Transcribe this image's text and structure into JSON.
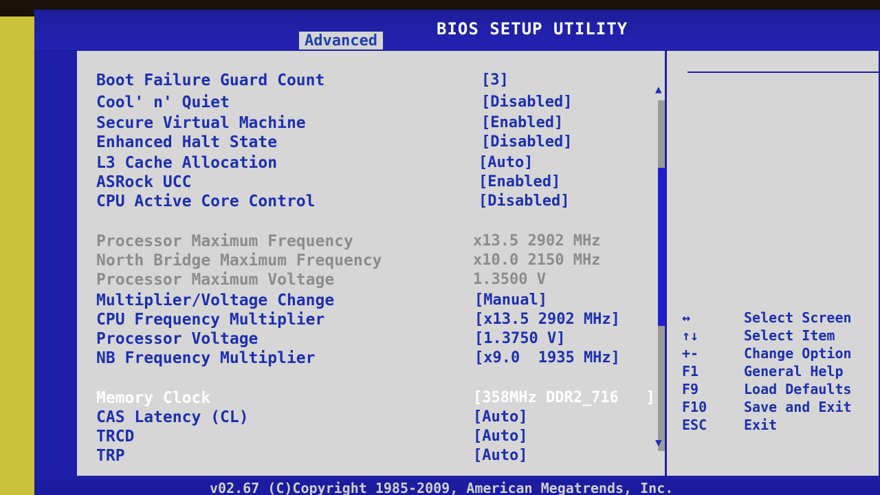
{
  "window": {
    "title": "BIOS SETUP UTILITY",
    "active_tab": "Advanced"
  },
  "settings": [
    {
      "label": "Boot Failure Guard Count",
      "value": "[3]",
      "kind": "setting"
    },
    {
      "label": "Cool' n' Quiet",
      "value": "[Disabled]",
      "kind": "setting"
    },
    {
      "label": "Secure Virtual Machine",
      "value": "[Enabled]",
      "kind": "setting"
    },
    {
      "label": "Enhanced Halt State",
      "value": "[Disabled]",
      "kind": "setting"
    },
    {
      "label": "L3 Cache Allocation",
      "value": "[Auto]",
      "kind": "setting"
    },
    {
      "label": "ASRock UCC",
      "value": "[Enabled]",
      "kind": "setting"
    },
    {
      "label": "CPU Active Core Control",
      "value": "[Disabled]",
      "kind": "setting"
    },
    {
      "label": "Processor Maximum Frequency",
      "value": "x13.5 2902 MHz",
      "kind": "info"
    },
    {
      "label": "North Bridge Maximum Frequency",
      "value": "x10.0 2150 MHz",
      "kind": "info"
    },
    {
      "label": "Processor Maximum Voltage",
      "value": "1.3500 V",
      "kind": "info"
    },
    {
      "label": "Multiplier/Voltage Change",
      "value": "[Manual]",
      "kind": "setting"
    },
    {
      "label": "CPU Frequency Multiplier",
      "value": "[x13.5 2902 MHz]",
      "kind": "setting"
    },
    {
      "label": "Processor Voltage",
      "value": "[1.3750 V]",
      "kind": "setting"
    },
    {
      "label": "NB Frequency Multiplier",
      "value": "[x9.0  1935 MHz]",
      "kind": "setting"
    },
    {
      "label": "Memory Clock",
      "value": "[358MHz DDR2_716   ]",
      "kind": "selected"
    },
    {
      "label": "CAS Latency (CL)",
      "value": "[Auto]",
      "kind": "setting"
    },
    {
      "label": "TRCD",
      "value": "[Auto]",
      "kind": "setting"
    },
    {
      "label": "TRP",
      "value": "[Auto]",
      "kind": "setting"
    }
  ],
  "key_help": [
    {
      "key": "↔",
      "desc": "Select Screen"
    },
    {
      "key": "↑↓",
      "desc": "Select Item"
    },
    {
      "key": "+-",
      "desc": "Change Option"
    },
    {
      "key": "F1",
      "desc": "General Help"
    },
    {
      "key": "F9",
      "desc": "Load Defaults"
    },
    {
      "key": "F10",
      "desc": "Save and Exit"
    },
    {
      "key": "ESC",
      "desc": "Exit"
    }
  ],
  "footer": {
    "copyright": "v02.67 (C)Copyright 1985-2009, American Megatrends, Inc."
  },
  "colors": {
    "accent_blue": "#1d2fb0",
    "panel_gray": "#d6d6d6",
    "info_gray": "#8c8c8c",
    "selected_white": "#ffffff"
  }
}
